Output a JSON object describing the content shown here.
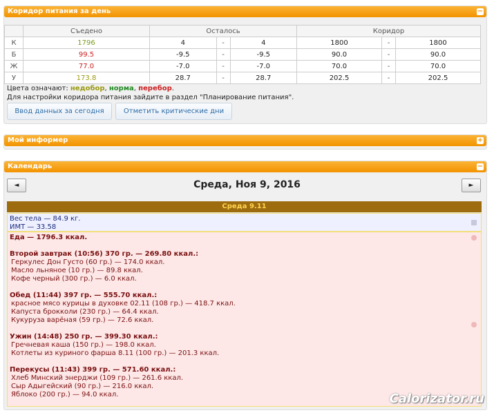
{
  "corridor": {
    "title": "Коридор питания за день",
    "headers": {
      "eaten": "Съедено",
      "left": "Осталось",
      "corridor": "Коридор"
    },
    "rows": [
      {
        "label": "К",
        "eaten": "1796",
        "eaten_color": "#7a9a1a",
        "left_a": "4",
        "left_b": "4",
        "cor_a": "1800",
        "cor_b": "1800"
      },
      {
        "label": "Б",
        "eaten": "99.5",
        "eaten_color": "#cc2020",
        "left_a": "-9.5",
        "left_b": "-9.5",
        "cor_a": "90.0",
        "cor_b": "90.0"
      },
      {
        "label": "Ж",
        "eaten": "77.0",
        "eaten_color": "#cc2020",
        "left_a": "-7.0",
        "left_b": "-7.0",
        "cor_a": "70.0",
        "cor_b": "70.0"
      },
      {
        "label": "У",
        "eaten": "173.8",
        "eaten_color": "#9a9a10",
        "left_a": "28.7",
        "left_b": "28.7",
        "cor_a": "202.5",
        "cor_b": "202.5"
      }
    ],
    "dash": "-",
    "legend_prefix": "Цвета означают: ",
    "legend_under": "недобор",
    "legend_norm": "норма",
    "legend_over": "перебор",
    "sep": ", ",
    "dot": ".",
    "hint": "Для настройки коридора питания зайдите в раздел \"Планирование питания\".",
    "btn_input": "Ввод данных за сегодня",
    "btn_critical": "Отметить критические дни",
    "toggle": "−"
  },
  "informer": {
    "title": "Мой информер",
    "toggle": "+"
  },
  "calendar": {
    "title": "Календарь",
    "toggle": "−",
    "prev": "◄",
    "next": "►",
    "date": "Среда, Ноя 9, 2016",
    "day_label": "Среда 9.11",
    "weight_line": "Вес тела — 84.9 кг.",
    "bmi_line": "ИМТ — 33.58",
    "food_total": "Еда — 1796.3 ккал.",
    "meals": [
      {
        "title": "Второй завтрак (10:56) 370 гр. — 269.80 ккал.:",
        "items": [
          "Геркулес Дон Густо (60 гр.) — 174.0 ккал.",
          "Масло льняное (10 гр.) — 89.8 ккал.",
          "Кофе черный (300 гр.) — 6.0 ккал."
        ]
      },
      {
        "title": "Обед (11:44) 397 гр. — 555.70 ккал.:",
        "items": [
          "красное мясо курицы в духовке 02.11 (108 гр.) — 418.7 ккал.",
          "Капуста брокколи (230 гр.) — 64.4 ккал.",
          "Кукуруза варёная (59 гр.) — 72.6 ккал."
        ]
      },
      {
        "title": "Ужин (14:48) 250 гр. — 399.30 ккал.:",
        "items": [
          "Гречневая каша (150 гр.) — 198.0 ккал.",
          "Котлеты из куриного фарша 8.11 (100 гр.) — 201.3 ккал."
        ]
      },
      {
        "title": "Перекусы (11:43) 399 гр. — 571.60 ккал.:",
        "items": [
          "Хлеб Минский энерджи (109 гр.) — 261.6 ккал.",
          "Сыр Адыгейский (90 гр.) — 216.0 ккал.",
          "Яблоко (200 гр.) — 94.0 ккал."
        ]
      }
    ]
  },
  "watermark": "Calorizator.ru",
  "colors": {
    "accent": "#f29300",
    "under": "#9a9a10",
    "norm": "#228b22",
    "over": "#cc2020"
  }
}
